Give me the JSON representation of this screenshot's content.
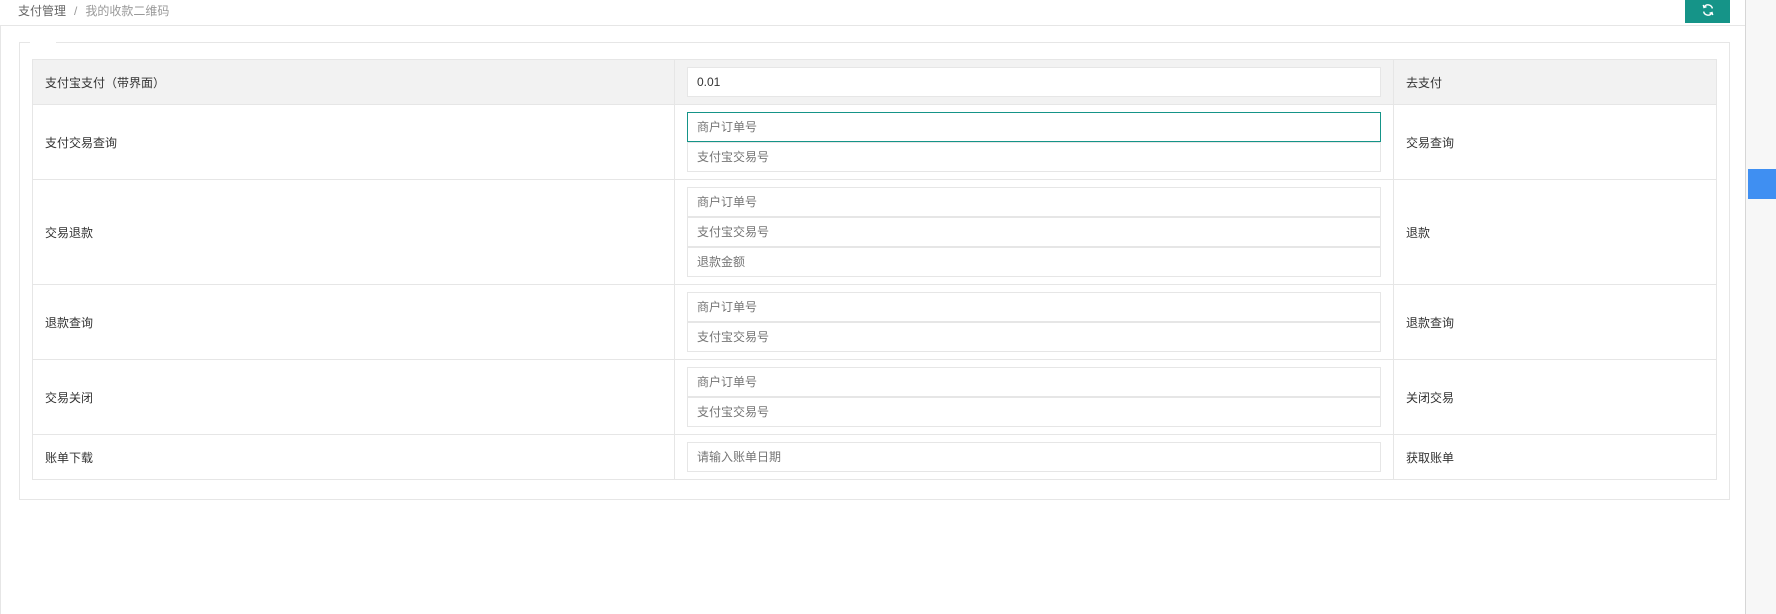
{
  "breadcrumb": {
    "parent": "支付管理",
    "separator": "/",
    "current": "我的收款二维码"
  },
  "colors": {
    "accent": "#159488",
    "side_marker": "#3f8ff2"
  },
  "toolbar": {
    "refresh_icon": "refresh-icon"
  },
  "rows": [
    {
      "label": "支付宝支付（带界面）",
      "fields": [
        {
          "value": "0.01",
          "placeholder": ""
        }
      ],
      "action": "去支付"
    },
    {
      "label": "支付交易查询",
      "fields": [
        {
          "value": "",
          "placeholder": "商户订单号"
        },
        {
          "value": "",
          "placeholder": "支付宝交易号"
        }
      ],
      "action": "交易查询"
    },
    {
      "label": "交易退款",
      "fields": [
        {
          "value": "",
          "placeholder": "商户订单号"
        },
        {
          "value": "",
          "placeholder": "支付宝交易号"
        },
        {
          "value": "",
          "placeholder": "退款金额"
        }
      ],
      "action": "退款"
    },
    {
      "label": "退款查询",
      "fields": [
        {
          "value": "",
          "placeholder": "商户订单号"
        },
        {
          "value": "",
          "placeholder": "支付宝交易号"
        }
      ],
      "action": "退款查询"
    },
    {
      "label": "交易关闭",
      "fields": [
        {
          "value": "",
          "placeholder": "商户订单号"
        },
        {
          "value": "",
          "placeholder": "支付宝交易号"
        }
      ],
      "action": "关闭交易"
    },
    {
      "label": "账单下载",
      "fields": [
        {
          "value": "",
          "placeholder": "请输入账单日期"
        }
      ],
      "action": "获取账单"
    }
  ]
}
